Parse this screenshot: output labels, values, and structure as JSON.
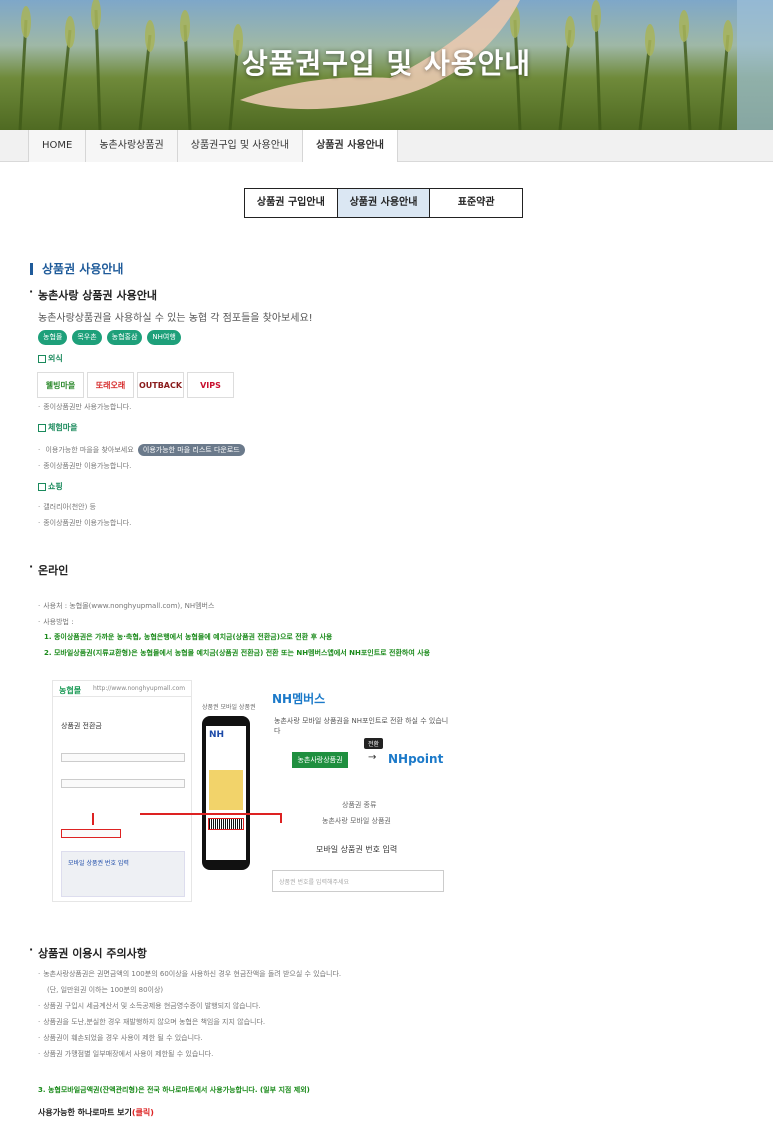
{
  "hero": {
    "title": "상품권구입 및 사용안내"
  },
  "breadcrumb": [
    "HOME",
    "농촌사랑상품권",
    "상품권구입 및 사용안내",
    "상품권 사용안내"
  ],
  "tabs": [
    {
      "label": "상품권 구입안내",
      "active": false
    },
    {
      "label": "상품권 사용안내",
      "active": true
    },
    {
      "label": "표준약관",
      "active": false
    }
  ],
  "section_title": "상품권 사용안내",
  "usage": {
    "heading": "농촌사랑 상품권 사용안내",
    "intro": "농촌사랑상품권을 사용하실 수 있는 농협 각 점포들을 찾아보세요!",
    "chips": [
      "농협몰",
      "목우촌",
      "농협홍삼",
      "NH여행"
    ],
    "dining": {
      "label": "외식",
      "brands": [
        "웰빙마을",
        "또래오래",
        "OUTBACK",
        "VIPS"
      ],
      "note": "종이상품권만 사용가능합니다."
    },
    "village": {
      "label": "체험마을",
      "note1": "이용가능한 마을을 찾아보세요",
      "download_button": "이용가능한 마을 리스트 다운로드",
      "note2": "종이상품권만 이용가능합니다."
    },
    "shopping": {
      "label": "쇼핑",
      "note1": "갤러리아(천안) 등",
      "note2": "종이상품권만 이용가능합니다."
    }
  },
  "online": {
    "heading": "온라인",
    "where": "사용처 : 농협몰(www.nonghyupmall.com), NH멤버스",
    "method": "사용방법 :",
    "step1": "1. 종이상품권은 가까운 농·축협, 농협은행에서 농협몰에 예치금(상품권 전환금)으로 전환 후 사용",
    "step2": "2. 모바일상품권(지류교환형)은 농협몰에서 농협몰 예치금(상품권 전환금) 전환 또는 NH멤버스앱에서 NH포인트로 전환하여 사용",
    "illustration": {
      "pc_logo": "농협몰",
      "pc_url": "http://www.nonghyupmall.com",
      "pc_title": "상품권 전환금",
      "pc_box": "모바일 상품권 번호 입력",
      "phone_caption": "상품권 모바일 상품권",
      "nh_members": "NH멤버스",
      "nh_sub": "농촌사랑 모바일 상품권을 NH포인트로 전환 하실 수 있습니다",
      "green_btn": "농촌사랑상품권",
      "badge": "전환",
      "arrow": "→",
      "nhpoint": "NHpoint",
      "kind_label": "상품권 종류",
      "kind_value": "농촌사랑 모바일 상품권",
      "input_title": "모바일 상품권 번호 입력",
      "input_placeholder": "상품권 번호를 입력해주세요"
    }
  },
  "caution": {
    "heading": "상품권 이용시 주의사항",
    "items": [
      "농촌사랑상품권은 권면금액의 100분의 60이상을 사용하신 경우 현금잔액을 돌려 받으실 수 있습니다.",
      "(단, 일만원권 이하는 100분의 80이상)",
      "상품권 구입시 세금계산서 및 소득공제용 현금영수증이 발행되지 않습니다.",
      "상품권을 도난,분실한 경우 재발행하지 않으며 농협은 책임을 지지 않습니다.",
      "상품권이 훼손되었을 경우 사용이 제한 될 수 있습니다.",
      "상품권 가맹점별 일부매장에서 사용이 제한될 수 있습니다."
    ],
    "note3": "3. 농협모바일금액권(잔액관리형)은 전국 하나로마트에서 사용가능합니다. (일부 지점 제외)",
    "hanaro_link": "사용가능한 하나로마트 보기",
    "click": "(클릭)"
  }
}
